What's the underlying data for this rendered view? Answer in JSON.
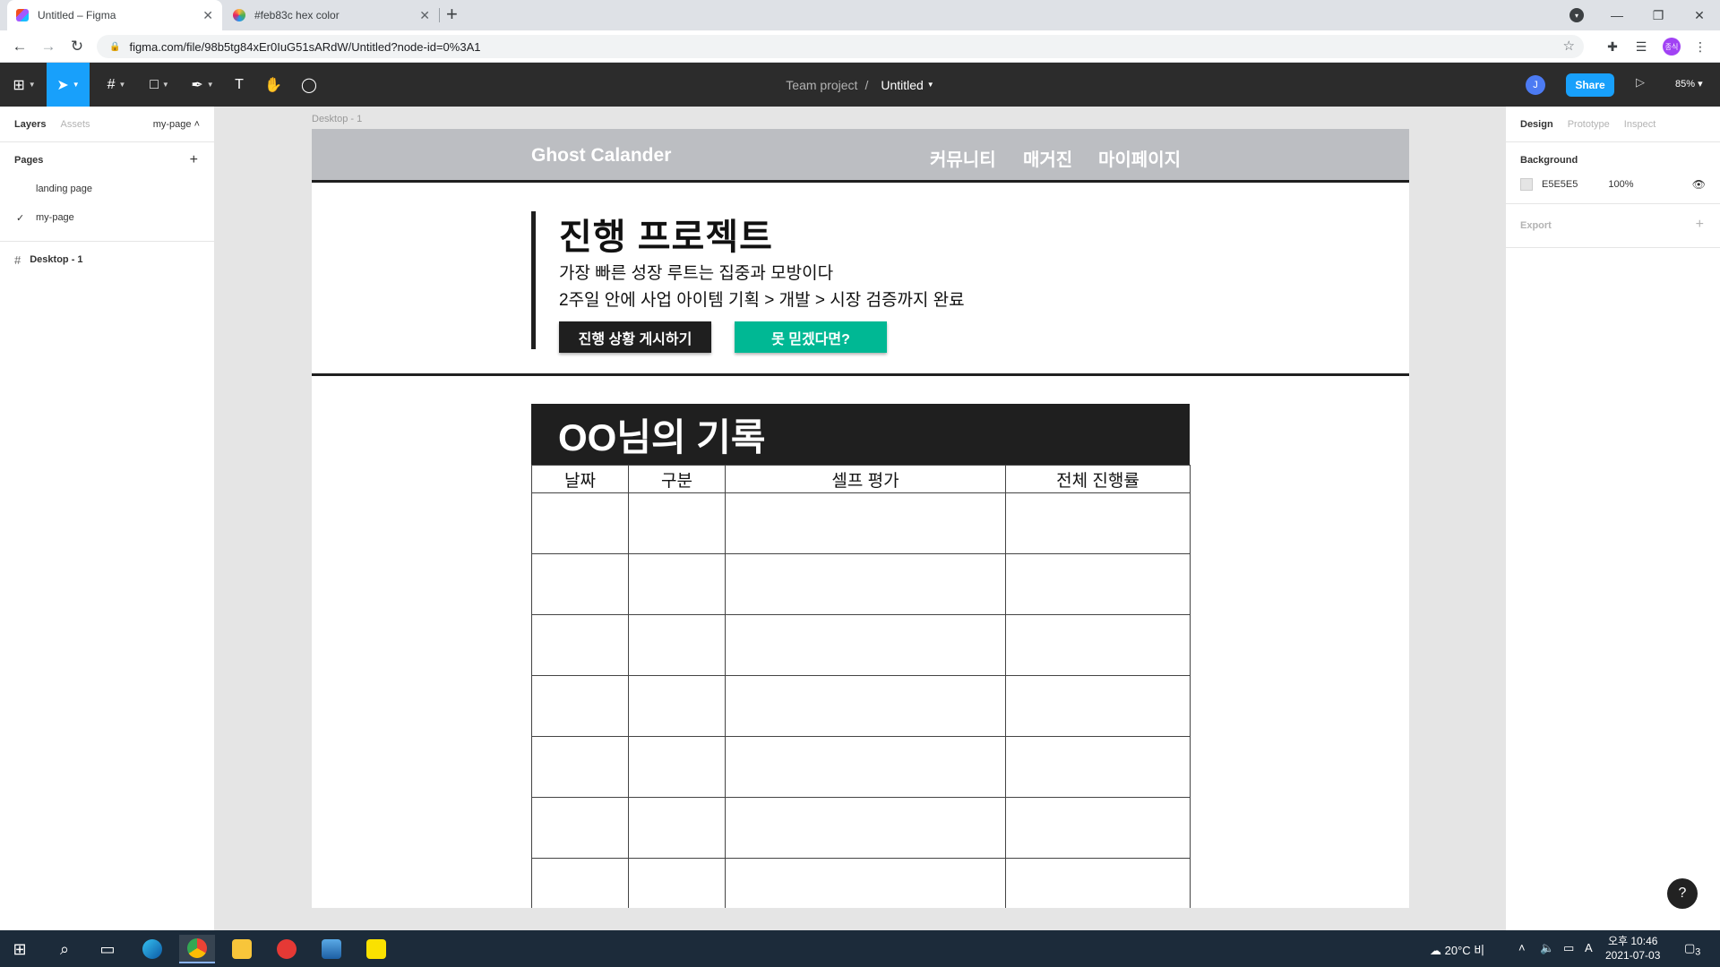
{
  "browser": {
    "tabs": [
      {
        "title": "Untitled – Figma",
        "active": true
      },
      {
        "title": "#feb83c hex color",
        "active": false
      }
    ],
    "url": "figma.com/file/98b5tg84xEr0IuG51sARdW/Untitled?node-id=0%3A1",
    "profile_initials": "종식"
  },
  "figma": {
    "breadcrumb_team": "Team project",
    "breadcrumb_separator": "/",
    "file_name": "Untitled",
    "user_initial": "J",
    "share_label": "Share",
    "zoom": "85%",
    "left_panel": {
      "tabs": [
        "Layers",
        "Assets"
      ],
      "current_page": "my-page",
      "pages_heading": "Pages",
      "pages": [
        "landing page",
        "my-page"
      ],
      "layers": [
        "Desktop - 1"
      ]
    },
    "right_panel": {
      "tabs": [
        "Design",
        "Prototype",
        "Inspect"
      ],
      "background_heading": "Background",
      "background_hex": "E5E5E5",
      "background_opacity": "100%",
      "export_heading": "Export"
    },
    "help_label": "?"
  },
  "design": {
    "frame_label": "Desktop - 1",
    "brand": "Ghost Calander",
    "nav": [
      "커뮤니티",
      "매거진",
      "마이페이지"
    ],
    "hero_title": "진행 프로젝트",
    "hero_sub1": "가장 빠른 성장 루트는 집중과 모방이다",
    "hero_sub2": "2주일 안에 사업 아이템 기획 > 개발 > 시장 검증까지 완료",
    "btn_post": "진행 상황 게시하기",
    "btn_doubt": "못 믿겠다면?",
    "record_title": "OO님의 기록",
    "columns": [
      "날짜",
      "구분",
      "셀프 평가",
      "전체 진행률"
    ]
  },
  "taskbar": {
    "weather": "20°C  비",
    "time": "오후 10:46",
    "date": "2021-07-03",
    "notifications": "3"
  },
  "colors": {
    "accent": "#18a0fb",
    "green_button": "#00b894",
    "dark": "#1f1f1f",
    "header_gray": "#bcbec2"
  }
}
